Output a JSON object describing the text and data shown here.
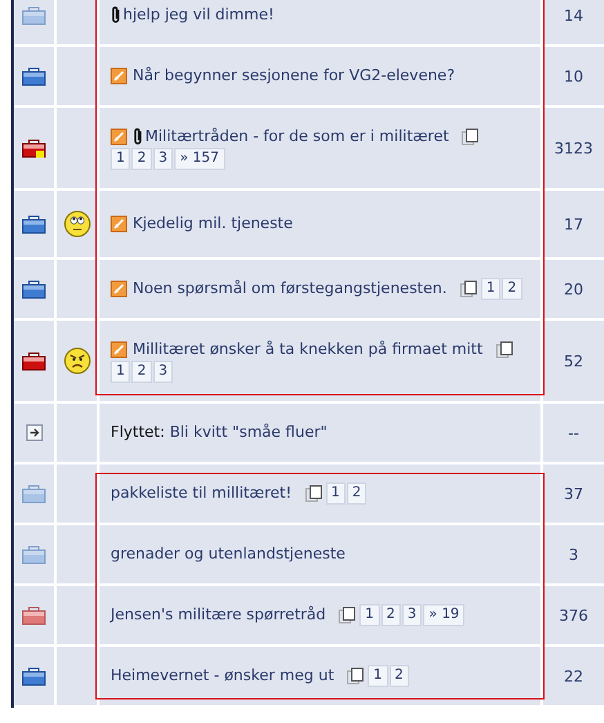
{
  "groups": [
    {
      "highlighted": true,
      "topics": [
        {
          "kind": "read",
          "attachment": true,
          "title": "hjelp jeg vil dimme!",
          "replies": "14"
        },
        {
          "kind": "new",
          "new_post": true,
          "title": "Når begynner sesjonene for VG2-elevene?",
          "replies": "10"
        },
        {
          "kind": "hot-new-mine",
          "new_post": true,
          "attachment": true,
          "title": "Militærtråden - for de som er i militæret",
          "pages": [
            "1",
            "2",
            "3",
            "» 157"
          ],
          "replies": "3123"
        },
        {
          "kind": "new",
          "emoticon": {
            "kind": "rolleyes"
          },
          "new_post": true,
          "title": "Kjedelig mil. tjeneste",
          "replies": "17"
        },
        {
          "kind": "new",
          "new_post": true,
          "title": "Noen spørsmål om førstegangstjenesten.",
          "pages": [
            "1",
            "2"
          ],
          "replies": "20"
        },
        {
          "kind": "hot-new",
          "emoticon": {
            "kind": "angry"
          },
          "new_post": true,
          "title": "Millitæret ønsker å ta knekken på firmaet mitt",
          "pages": [
            "1",
            "2",
            "3"
          ],
          "replies": "52"
        }
      ]
    },
    {
      "topics": [
        {
          "kind": "moved",
          "prefix": "Flyttet:",
          "title": "Bli kvitt \"småe fluer\"",
          "replies": "--"
        }
      ]
    },
    {
      "highlighted": true,
      "topics": [
        {
          "kind": "read",
          "title": "pakkeliste til millitæret!",
          "pages": [
            "1",
            "2"
          ],
          "replies": "37"
        },
        {
          "kind": "read",
          "title": "grenader og utenlandstjeneste",
          "replies": "3"
        },
        {
          "kind": "hot-read",
          "title": "Jensen's militære spørretråd",
          "pages": [
            "1",
            "2",
            "3",
            "» 19"
          ],
          "replies": "376"
        },
        {
          "kind": "new",
          "title": "Heimevernet - ønsker meg ut",
          "pages": [
            "1",
            "2"
          ],
          "replies": "22"
        }
      ]
    }
  ]
}
